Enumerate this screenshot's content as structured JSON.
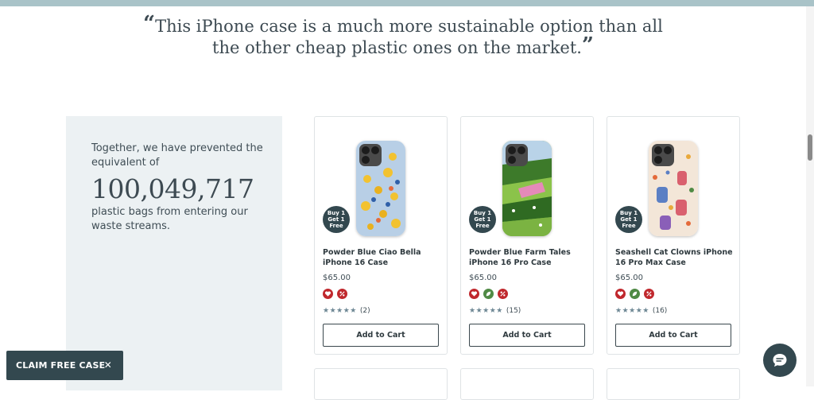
{
  "quote": {
    "open_mark": "“",
    "line1": "This iPhone case is a much more sustainable option than all",
    "line2": "the other cheap plastic ones on the market.",
    "close_mark": "”"
  },
  "impact": {
    "pre_text": "Together, we have prevented the equivalent of",
    "number": "100,049,717",
    "post_text": "plastic bags from entering our waste streams."
  },
  "products": [
    {
      "name": "Powder Blue Ciao Bella iPhone 16 Case",
      "price": "$65.00",
      "reviews": "(2)",
      "badge": "Buy 1\nGet 1\nFree",
      "cta": "Add to Cart"
    },
    {
      "name": "Powder Blue Farm Tales iPhone 16 Pro Case",
      "price": "$65.00",
      "reviews": "(15)",
      "badge": "Buy 1\nGet 1\nFree",
      "cta": "Add to Cart"
    },
    {
      "name": "Seashell Cat Clowns iPhone 16 Pro Max Case",
      "price": "$65.00",
      "reviews": "(16)",
      "badge": "Buy 1\nGet 1\nFree",
      "cta": "Add to Cart"
    }
  ],
  "stars": "★★★★★",
  "claim": {
    "label": "CLAIM FREE CASE",
    "close": "✕"
  },
  "colors": {
    "accent": "#33484f",
    "topbar": "#a9c3c8",
    "panel": "#ecf1f3",
    "icon_red": "#c0282d",
    "icon_green": "#4f8a45"
  },
  "icons": [
    "heart-icon",
    "leaf-icon",
    "percent-icon",
    "chat-icon",
    "close-icon"
  ]
}
